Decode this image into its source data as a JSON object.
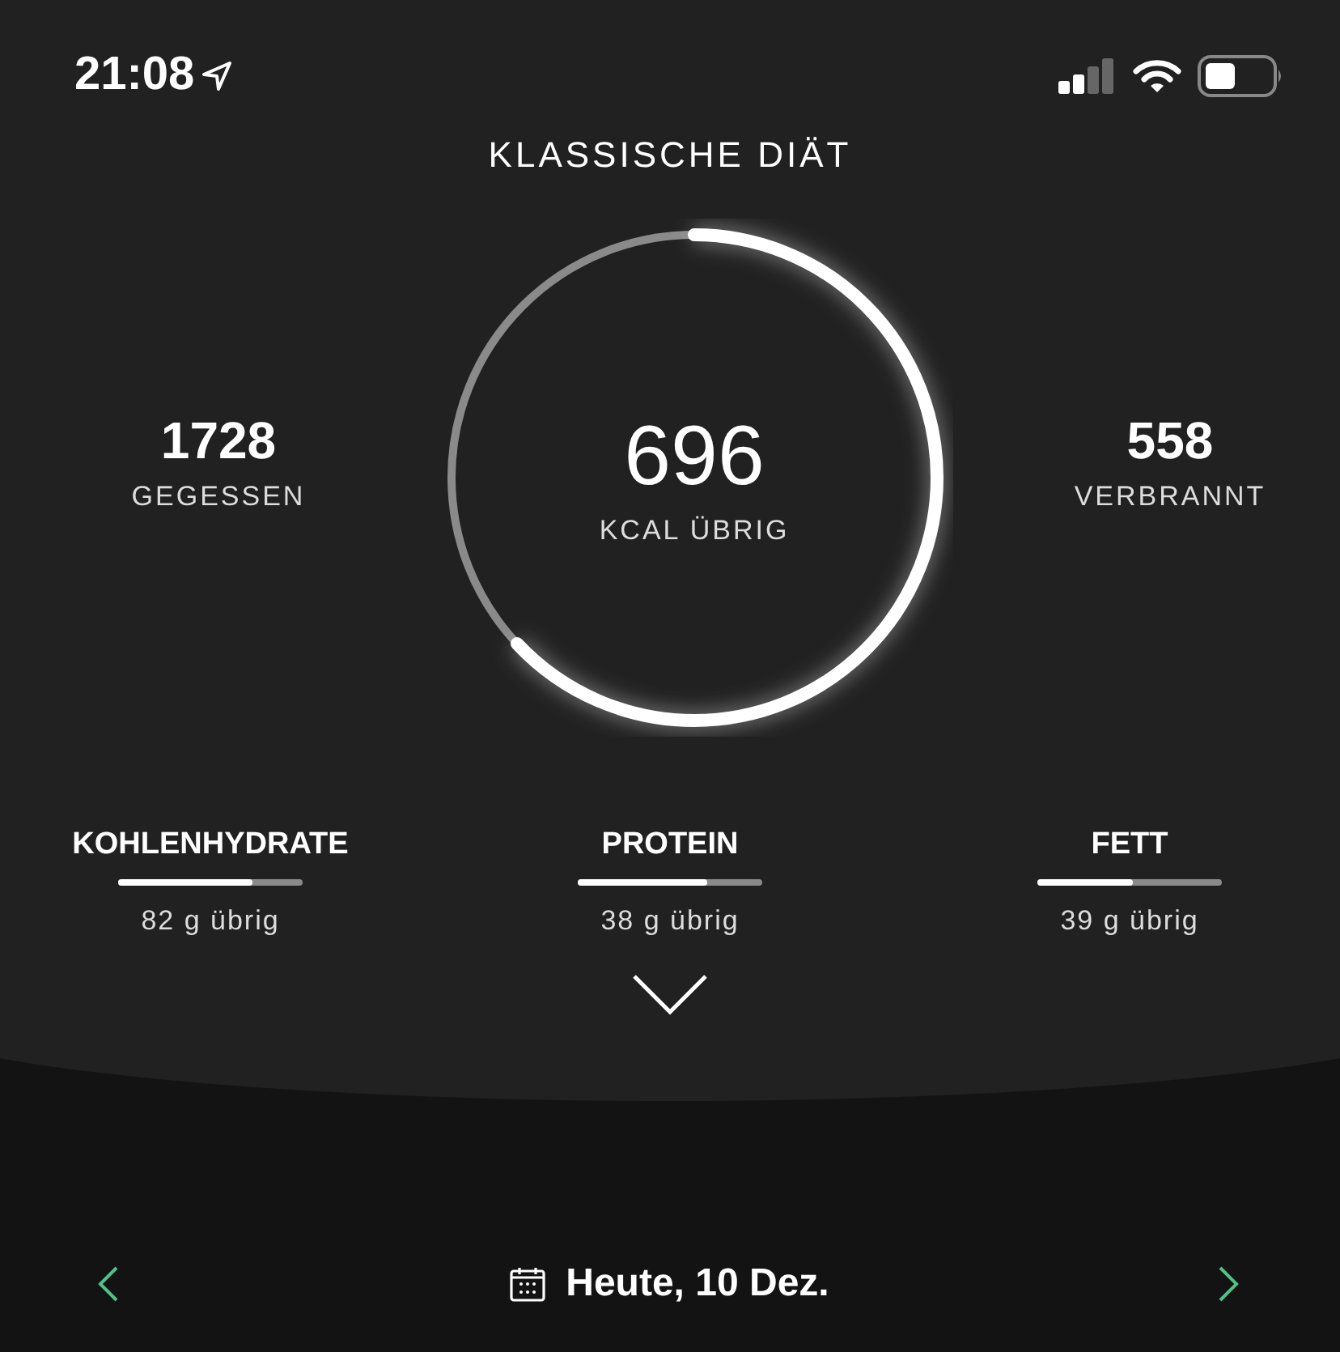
{
  "status_bar": {
    "time": "21:08"
  },
  "title": "KLASSISCHE DIÄT",
  "eaten": {
    "value": "1728",
    "label": "GEGESSEN"
  },
  "remaining": {
    "value": "696",
    "label": "KCAL ÜBRIG"
  },
  "burned": {
    "value": "558",
    "label": "VERBRANNT"
  },
  "macros": [
    {
      "name": "KOHLENHYDRATE",
      "level": 0.73,
      "reading": "82 g übrig"
    },
    {
      "name": "PROTEIN",
      "level": 0.7,
      "reading": "38 g übrig"
    },
    {
      "name": "FETT",
      "level": 0.52,
      "reading": "39 g übrig"
    }
  ],
  "date_bar": {
    "label": "Heute, 10 Dez."
  }
}
